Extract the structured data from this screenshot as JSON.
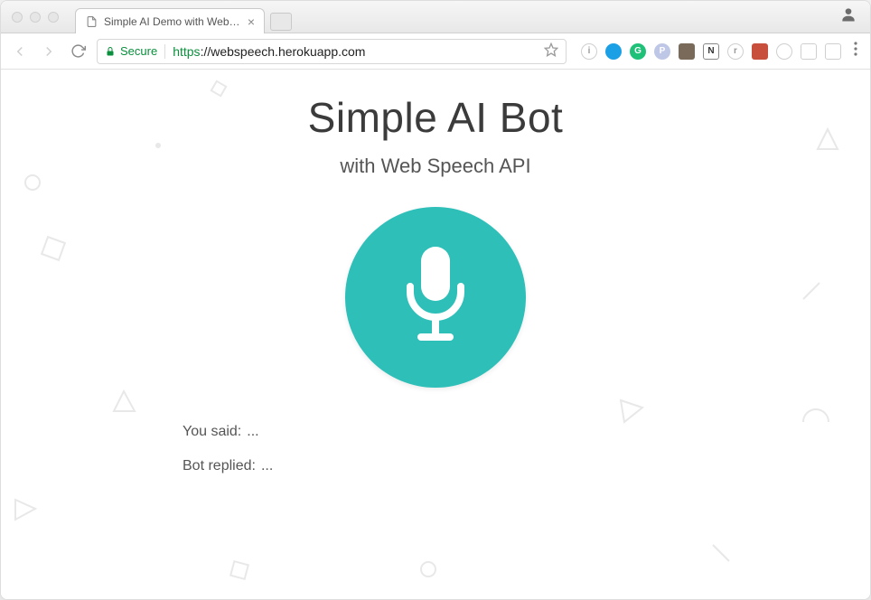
{
  "window": {
    "tab_title": "Simple AI Demo with Web Spe..."
  },
  "toolbar": {
    "secure_label": "Secure",
    "url_scheme": "https",
    "url_host": "://webspeech.herokuapp.com"
  },
  "extensions": [
    {
      "name": "info-icon",
      "label": "i",
      "bg": "transparent",
      "fg": "#9a9a9a",
      "shape": "circle"
    },
    {
      "name": "ext-blue-dot",
      "label": "",
      "bg": "#1ba0e6",
      "fg": "#fff",
      "shape": "circle"
    },
    {
      "name": "ext-grammarly",
      "label": "G",
      "bg": "#1fc178",
      "fg": "#fff",
      "shape": "circle"
    },
    {
      "name": "ext-p",
      "label": "P",
      "bg": "#bfc7e6",
      "fg": "#fff",
      "shape": "circle"
    },
    {
      "name": "ext-pic",
      "label": "",
      "bg": "#7a6a5a",
      "fg": "#fff",
      "shape": "square"
    },
    {
      "name": "ext-n",
      "label": "N",
      "bg": "#ffffff",
      "fg": "#333",
      "shape": "square-outline"
    },
    {
      "name": "ext-r",
      "label": "r",
      "bg": "transparent",
      "fg": "#9a9a9a",
      "shape": "circle"
    },
    {
      "name": "ext-red",
      "label": "",
      "bg": "#c94f3d",
      "fg": "#fff",
      "shape": "square"
    },
    {
      "name": "ext-octo",
      "label": "",
      "bg": "transparent",
      "fg": "#b0a6e8",
      "shape": "circle"
    },
    {
      "name": "cast-icon",
      "label": "",
      "bg": "transparent",
      "fg": "#9a9a9a",
      "shape": "square"
    },
    {
      "name": "ext-pin",
      "label": "",
      "bg": "transparent",
      "fg": "#c2a96a",
      "shape": "square"
    }
  ],
  "page": {
    "title": "Simple AI Bot",
    "subtitle": "with Web Speech API",
    "you_said_label": "You said:",
    "you_said_value": "...",
    "bot_replied_label": "Bot replied:",
    "bot_replied_value": "..."
  },
  "colors": {
    "mic_bg": "#2ebfb9",
    "secure_green": "#0a8f3c"
  }
}
